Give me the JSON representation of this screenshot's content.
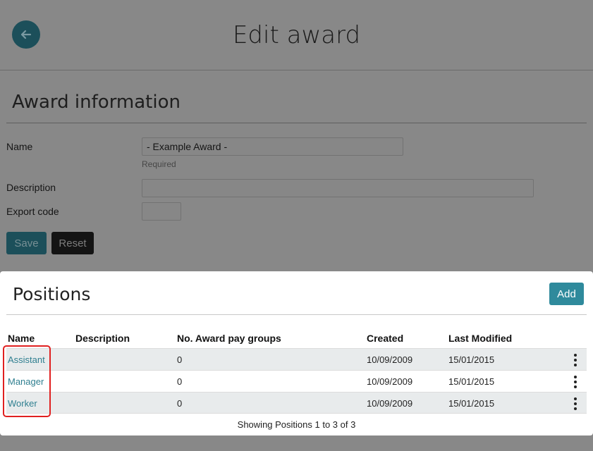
{
  "header": {
    "title": "Edit award"
  },
  "award_info": {
    "section_title": "Award information",
    "name_label": "Name",
    "name_value": "- Example Award -",
    "name_help": "Required",
    "description_label": "Description",
    "description_value": "",
    "export_code_label": "Export code",
    "export_code_value": "",
    "save_label": "Save",
    "reset_label": "Reset"
  },
  "positions": {
    "title": "Positions",
    "add_label": "Add",
    "columns": [
      "Name",
      "Description",
      "No. Award pay groups",
      "Created",
      "Last Modified"
    ],
    "rows": [
      {
        "name": "Assistant",
        "description": "",
        "pay_groups": "0",
        "created": "10/09/2009",
        "modified": "15/01/2015"
      },
      {
        "name": "Manager",
        "description": "",
        "pay_groups": "0",
        "created": "10/09/2009",
        "modified": "15/01/2015"
      },
      {
        "name": "Worker",
        "description": "",
        "pay_groups": "0",
        "created": "10/09/2009",
        "modified": "15/01/2015"
      }
    ],
    "footer": "Showing Positions 1 to 3 of 3"
  },
  "colors": {
    "overlay": "#888888",
    "accent": "#2f8a9c",
    "highlight": "#e02020"
  }
}
